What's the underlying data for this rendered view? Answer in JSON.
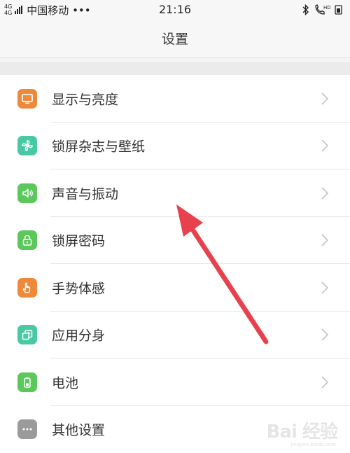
{
  "status_bar": {
    "network_types": [
      "4G",
      "4G"
    ],
    "carrier": "中国移动 •••",
    "time": "21:16",
    "icons": [
      "bluetooth-icon",
      "hd-call-icon"
    ]
  },
  "header": {
    "title": "设置"
  },
  "settings": {
    "items": [
      {
        "label": "显示与亮度",
        "icon": "display-icon",
        "color": "#f0883a"
      },
      {
        "label": "锁屏杂志与壁纸",
        "icon": "pinwheel-icon",
        "color": "#48c9a4"
      },
      {
        "label": "声音与振动",
        "icon": "speaker-icon",
        "color": "#5ac85a"
      },
      {
        "label": "锁屏密码",
        "icon": "lock-icon",
        "color": "#5ac85a"
      },
      {
        "label": "手势体感",
        "icon": "hand-icon",
        "color": "#f0883a"
      },
      {
        "label": "应用分身",
        "icon": "app-clone-icon",
        "color": "#48c9a4"
      },
      {
        "label": "电池",
        "icon": "battery-icon",
        "color": "#5ac85a"
      },
      {
        "label": "其他设置",
        "icon": "more-icon",
        "color": "#9a9a9a"
      }
    ]
  },
  "watermark": {
    "text": "Bai 经验",
    "sub": "jingyan.baidu.com"
  },
  "colors": {
    "annotation_arrow": "#e8414e",
    "chevron": "#c4c4c4"
  }
}
